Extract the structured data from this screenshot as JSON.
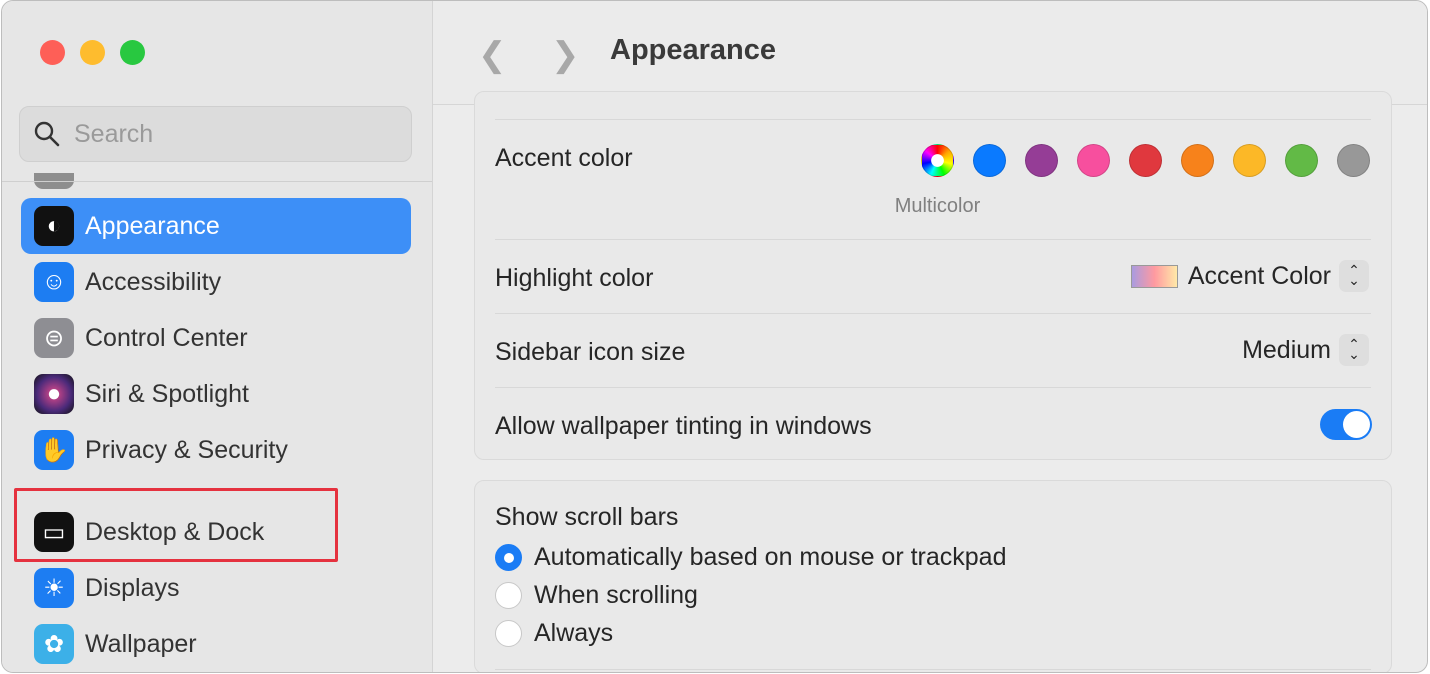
{
  "window": {
    "title": "Appearance"
  },
  "sidebar": {
    "search_placeholder": "Search",
    "items": [
      {
        "label": "Appearance",
        "icon": "appearance-icon",
        "color": "#111111",
        "selected": true
      },
      {
        "label": "Accessibility",
        "icon": "accessibility-icon",
        "color": "#1d7df2"
      },
      {
        "label": "Control Center",
        "icon": "control-center-icon",
        "color": "#8e8e93"
      },
      {
        "label": "Siri & Spotlight",
        "icon": "siri-icon",
        "color": "#6b2f8a"
      },
      {
        "label": "Privacy & Security",
        "icon": "hand-icon",
        "color": "#1d7df2"
      },
      {
        "label": "Desktop & Dock",
        "icon": "dock-icon",
        "color": "#111111",
        "highlighted": true
      },
      {
        "label": "Displays",
        "icon": "sun-icon",
        "color": "#1d7df2"
      },
      {
        "label": "Wallpaper",
        "icon": "flower-icon",
        "color": "#3cb0e8"
      }
    ]
  },
  "main": {
    "accent": {
      "label": "Accent color",
      "selected_name": "Multicolor",
      "colors": [
        "multicolor",
        "#0a7aff",
        "#953d96",
        "#f74f9e",
        "#e0383e",
        "#f7821b",
        "#fcb827",
        "#62ba46",
        "#989898"
      ]
    },
    "highlight": {
      "label": "Highlight color",
      "value": "Accent Color"
    },
    "sidebar_icon_size": {
      "label": "Sidebar icon size",
      "value": "Medium"
    },
    "tinting": {
      "label": "Allow wallpaper tinting in windows",
      "on": true
    },
    "scroll_bars": {
      "label": "Show scroll bars",
      "options": [
        "Automatically based on mouse or trackpad",
        "When scrolling",
        "Always"
      ],
      "selected": 0
    }
  },
  "colors": {
    "accent": "#3d8ff7",
    "annotation": "#e5323f"
  }
}
